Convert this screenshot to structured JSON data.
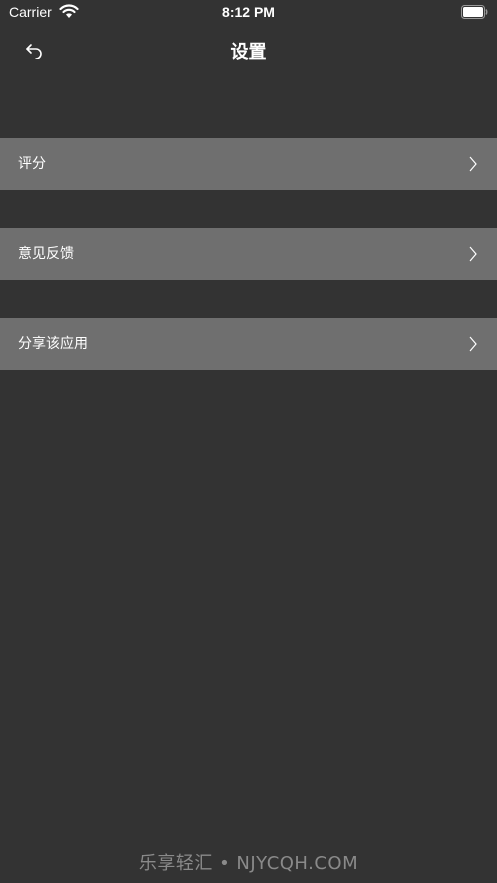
{
  "status_bar": {
    "carrier": "Carrier",
    "time": "8:12 PM",
    "wifi_icon": "wifi-icon",
    "battery_icon": "battery-icon"
  },
  "nav": {
    "title": "设置",
    "back_icon": "back-arrow-icon"
  },
  "rows": [
    {
      "label": "评分",
      "icon": "chevron-right-icon"
    },
    {
      "label": "意见反馈",
      "icon": "chevron-right-icon"
    },
    {
      "label": "分享该应用",
      "icon": "chevron-right-icon"
    }
  ],
  "watermark": "乐享轻汇 • NJYCQH.COM",
  "colors": {
    "background": "#333333",
    "row_background": "#6f6f6f",
    "text": "#ffffff",
    "watermark": "#8a8a8a"
  }
}
